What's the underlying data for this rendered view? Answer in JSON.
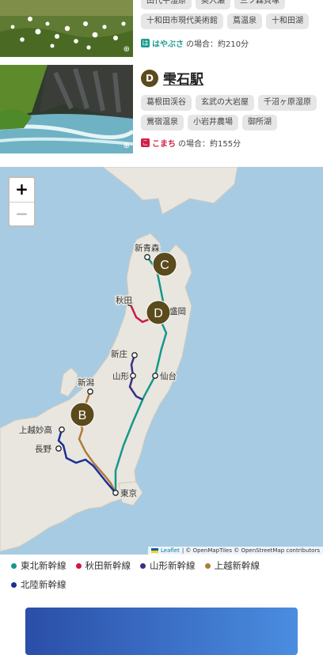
{
  "card1": {
    "tags": [
      "田代平湿原",
      "奥入瀬",
      "三ツ森貝塚",
      "十和田市現代美術館",
      "蔦温泉",
      "十和田湖"
    ],
    "route": {
      "badge": "は",
      "train": "はやぶさ",
      "suffix": "の場合：約210分",
      "color": "#1a9c8e"
    }
  },
  "card2": {
    "marker": "D",
    "station": "雫石駅",
    "tags": [
      "葛根田渓谷",
      "玄武の大岩屋",
      "千沼ヶ原湿原",
      "鶯宿温泉",
      "小岩井農場",
      "御所湖"
    ],
    "route": {
      "badge": "こ",
      "train": "こまち",
      "suffix": "の場合：約155分",
      "color": "#cf1f45"
    }
  },
  "map": {
    "zoom_in": "+",
    "zoom_out": "−",
    "stations": [
      "新青森",
      "秋田",
      "盛岡",
      "新庄",
      "山形",
      "仙台",
      "新潟",
      "上越妙高",
      "長野",
      "東京"
    ],
    "markers": [
      "C",
      "D",
      "B"
    ],
    "attribution": {
      "leaflet": "Leaflet",
      "rest": "| © OpenMapTiles © OpenStreetMap contributors"
    }
  },
  "legend": [
    {
      "label": "東北新幹線",
      "color": "#17968a"
    },
    {
      "label": "秋田新幹線",
      "color": "#d0173f"
    },
    {
      "label": "山形新幹線",
      "color": "#3a2f86"
    },
    {
      "label": "上越新幹線",
      "color": "#b07a3c"
    },
    {
      "label": "北陸新幹線",
      "color": "#1c2f96"
    }
  ]
}
